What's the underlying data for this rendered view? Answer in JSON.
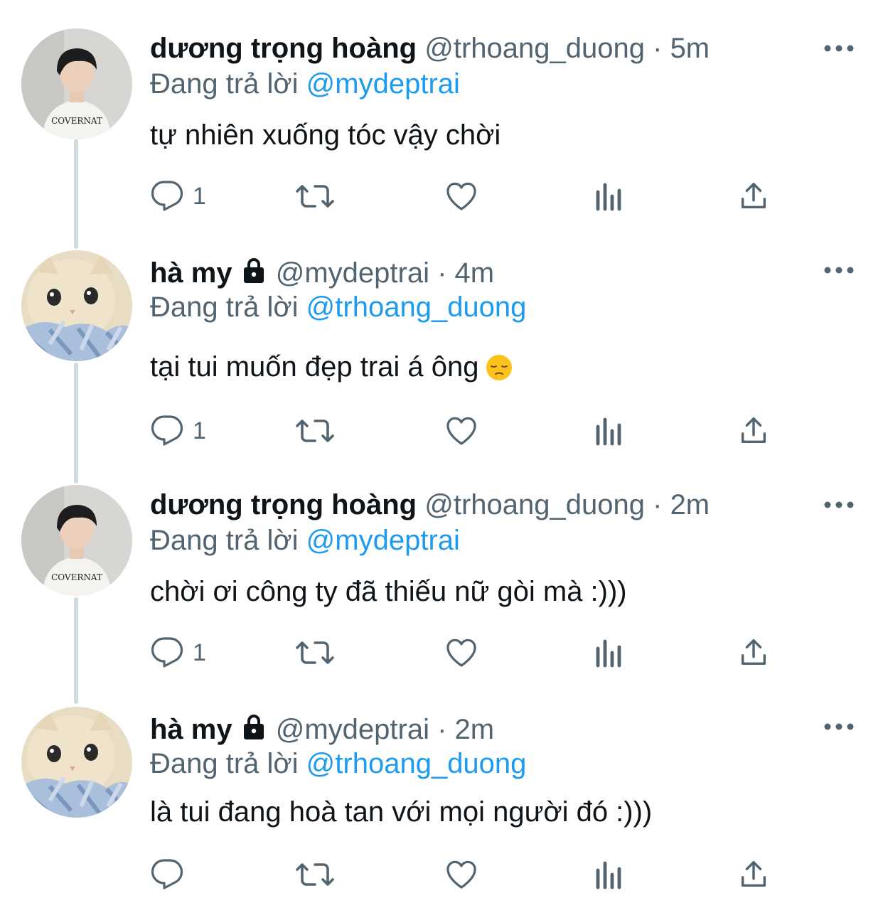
{
  "tweets": [
    {
      "name": "dương trọng hoàng",
      "handle": "@trhoang_duong",
      "sep": "·",
      "time": "5m",
      "reply_prefix": "Đang trả lời",
      "reply_to": "@mydeptrai",
      "text": "tự nhiên xuống tóc vậy chời",
      "reply_count": "1",
      "avatar": "person-avatar",
      "locked": false
    },
    {
      "name": "hà my",
      "handle": "@mydeptrai",
      "sep": "·",
      "time": "4m",
      "reply_prefix": "Đang trả lời",
      "reply_to": "@trhoang_duong",
      "text": "tại tui muốn đẹp trai á ông",
      "emoji": "pensive-face",
      "reply_count": "1",
      "avatar": "cat-avatar",
      "locked": true
    },
    {
      "name": "dương trọng hoàng",
      "handle": "@trhoang_duong",
      "sep": "·",
      "time": "2m",
      "reply_prefix": "Đang trả lời",
      "reply_to": "@mydeptrai",
      "text": "chời ơi công ty đã thiếu nữ gòi mà :)))",
      "reply_count": "1",
      "avatar": "person-avatar",
      "locked": false
    },
    {
      "name": "hà my",
      "handle": "@mydeptrai",
      "sep": "·",
      "time": "2m",
      "reply_prefix": "Đang trả lời",
      "reply_to": "@trhoang_duong",
      "text": "là tui đang hoà tan với mọi người đó :)))",
      "reply_count": "",
      "avatar": "cat-avatar",
      "locked": true
    }
  ],
  "avatar_shirt_text": "COVERNAT",
  "colors": {
    "text": "#0f1419",
    "secondary": "#536471",
    "link": "#1d9bf0",
    "thread_line": "#cfd9de"
  },
  "icons": [
    "reply-icon",
    "retweet-icon",
    "like-icon",
    "views-icon",
    "share-icon",
    "more-icon",
    "lock-icon"
  ]
}
